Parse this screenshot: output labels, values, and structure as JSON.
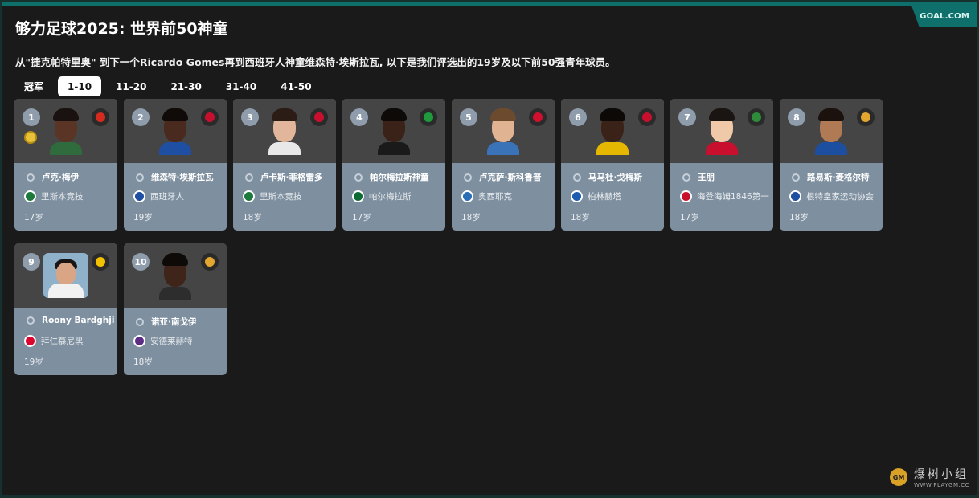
{
  "header": {
    "title": "够力足球2025: 世界前50神童",
    "subtitle": "从\"捷克帕特里奥\" 到下一个Ricardo Gomes再到西班牙人神童维森特·埃斯拉瓦, 以下是我们评选出的19岁及以下前50强青年球员。",
    "brand": "GOAL.COM"
  },
  "tabs": [
    "冠军",
    "1-10",
    "11-20",
    "21-30",
    "31-40",
    "41-50"
  ],
  "active_tab": "1-10",
  "players": [
    {
      "rank": "1",
      "name": "卢克·梅伊",
      "club": "里斯本竞技",
      "age": "17岁",
      "flag_icon": "canada-flag-icon",
      "club_icon": "sporting-cp-crest-icon",
      "flag_color": "#d52b1e",
      "club_color": "#1e7a3c",
      "skin": "#5a3526",
      "hair": "#1a1210",
      "shirt": "#2f6b3c"
    },
    {
      "rank": "2",
      "name": "维森特·埃斯拉瓦",
      "club": "西班牙人",
      "age": "19岁",
      "flag_icon": "basque-flag-icon",
      "club_icon": "espanyol-crest-icon",
      "flag_color": "#c8102e",
      "club_color": "#1f4fa3",
      "skin": "#4a2a1e",
      "hair": "#100b09",
      "shirt": "#1f4fa3"
    },
    {
      "rank": "3",
      "name": "卢卡斯·菲格雷多",
      "club": "里斯本竞技",
      "age": "18岁",
      "flag_icon": "portugal-flag-icon",
      "club_icon": "sporting-cp-crest-icon",
      "flag_color": "#c8102e",
      "club_color": "#1e7a3c",
      "skin": "#e2b69a",
      "hair": "#2b1d16",
      "shirt": "#e8e8e8"
    },
    {
      "rank": "4",
      "name": "帕尔梅拉斯神童",
      "club": "帕尔梅拉斯",
      "age": "17岁",
      "flag_icon": "brazil-flag-icon",
      "club_icon": "palmeiras-crest-icon",
      "flag_color": "#1e9a3c",
      "club_color": "#0b6b33",
      "skin": "#3a2219",
      "hair": "#0e0a08",
      "shirt": "#1a1a1a"
    },
    {
      "rank": "5",
      "name": "卢克萨·斯科鲁普",
      "club": "奥西耶克",
      "age": "18岁",
      "flag_icon": "croatia-flag-icon",
      "club_icon": "osijek-crest-icon",
      "flag_color": "#d0102e",
      "club_color": "#2a6fb5",
      "skin": "#e0b393",
      "hair": "#6b4a2e",
      "shirt": "#3b73b9"
    },
    {
      "rank": "6",
      "name": "马马杜·戈梅斯",
      "club": "柏林赫塔",
      "age": "18岁",
      "flag_icon": "portugal-flag-icon",
      "club_icon": "hertha-crest-icon",
      "flag_color": "#c8102e",
      "club_color": "#1c5bb0",
      "skin": "#3b2218",
      "hair": "#0d0907",
      "shirt": "#e6b700"
    },
    {
      "rank": "7",
      "name": "王朋",
      "club": "海登海姆1846第一",
      "age": "17岁",
      "flag_icon": "germany-flag-icon",
      "club_icon": "heidenheim-crest-icon",
      "flag_color": "#2e8b3a",
      "club_color": "#c8102e",
      "skin": "#efc9a8",
      "hair": "#1a1412",
      "shirt": "#c8102e"
    },
    {
      "rank": "8",
      "name": "路易斯·菱格尔特",
      "club": "根特皇家运动协会",
      "age": "18岁",
      "flag_icon": "belgium-flag-icon",
      "club_icon": "gent-crest-icon",
      "flag_color": "#e3a72f",
      "club_color": "#1d4fa0",
      "skin": "#b07a55",
      "hair": "#1b120d",
      "shirt": "#1d4fa0"
    },
    {
      "rank": "9",
      "name": "Roony Bardghji",
      "club": "拜仁慕尼黑",
      "age": "19岁",
      "flag_icon": "sweden-flag-icon",
      "club_icon": "bayern-crest-icon",
      "flag_color": "#f2c200",
      "club_color": "#dc052d",
      "skin": "#d9a585",
      "hair": "#1a1412",
      "shirt": "#f1f1f1"
    },
    {
      "rank": "10",
      "name": "诺亚·南戈伊",
      "club": "安德莱赫特",
      "age": "18岁",
      "flag_icon": "belgium-flag-icon",
      "club_icon": "anderlecht-crest-icon",
      "flag_color": "#e3a72f",
      "club_color": "#5b2d86",
      "skin": "#3f241a",
      "hair": "#0e0a08",
      "shirt": "#2d2d2d"
    }
  ],
  "watermark": {
    "cn": "爆树小组",
    "url": "WWW.PLAYGM.CC",
    "logo": "GM"
  }
}
